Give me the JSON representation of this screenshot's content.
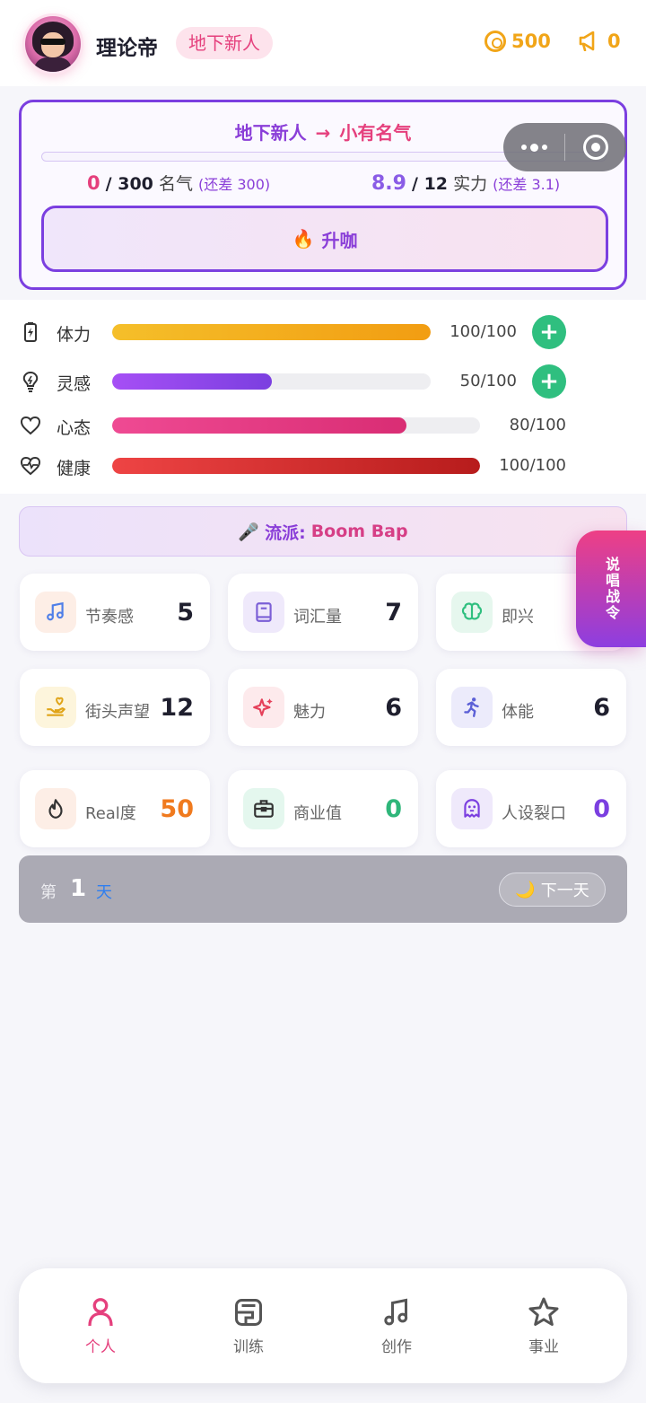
{
  "header": {
    "name": "理论帝",
    "rank_badge": "地下新人",
    "coins": "500",
    "fans": "0"
  },
  "promotion": {
    "from_rank": "地下新人",
    "arrow": "→",
    "to_rank": "小有名气",
    "progress_fraction": 0.0,
    "fame_current": "0",
    "fame_sep_total": "/ 300",
    "fame_label": "名气",
    "fame_gap": "(还差 300)",
    "power_current": "8.9",
    "power_sep_total": "/ 12",
    "power_label": "实力",
    "power_gap": "(还差 3.1)",
    "button_label": "升咖",
    "button_icon": "🔥"
  },
  "vitals": [
    {
      "label": "体力",
      "value_text": "100/100",
      "fraction": 1.0,
      "color_from": "#f5bf2a",
      "color_to": "#f29d12",
      "has_plus": true,
      "icon": "battery-icon"
    },
    {
      "label": "灵感",
      "value_text": "50/100",
      "fraction": 0.5,
      "color_from": "#a64ff5",
      "color_to": "#7b3fe0",
      "has_plus": true,
      "icon": "lightbulb-icon"
    },
    {
      "label": "心态",
      "value_text": "80/100",
      "fraction": 0.8,
      "color_from": "#ef4a93",
      "color_to": "#d92d74",
      "has_plus": false,
      "icon": "heart-icon"
    },
    {
      "label": "健康",
      "value_text": "100/100",
      "fraction": 1.0,
      "color_from": "#ee4444",
      "color_to": "#b71c1c",
      "has_plus": false,
      "icon": "heartbeat-icon"
    }
  ],
  "genre": {
    "icon": "🎤",
    "label": "流派:",
    "value": "Boom Bap"
  },
  "attributes": [
    {
      "label": "节奏感",
      "value": "5",
      "icon": "music-note-icon",
      "bg": "#fdeee6",
      "fg": "#4f7fe8",
      "value_color": "#1f1f2e"
    },
    {
      "label": "词汇量",
      "value": "7",
      "icon": "book-icon",
      "bg": "#efe9fb",
      "fg": "#7b5fd6",
      "value_color": "#1f1f2e"
    },
    {
      "label": "即兴",
      "value": "",
      "icon": "brain-icon",
      "bg": "#e6f7ee",
      "fg": "#2fbf7f",
      "value_color": "#1f1f2e"
    },
    {
      "label": "街头声望",
      "value": "12",
      "icon": "hand-icon",
      "bg": "#fdf5dc",
      "fg": "#e0a418",
      "value_color": "#1f1f2e"
    },
    {
      "label": "魅力",
      "value": "6",
      "icon": "sparkle-icon",
      "bg": "#fdeaec",
      "fg": "#e5405a",
      "value_color": "#1f1f2e"
    },
    {
      "label": "体能",
      "value": "6",
      "icon": "runner-icon",
      "bg": "#ecebfb",
      "fg": "#5b5fd6",
      "value_color": "#1f1f2e"
    },
    {
      "label": "Real度",
      "value": "50",
      "icon": "flame-icon",
      "bg": "#fdeee6",
      "fg": "#333333",
      "value_color": "#f07a1e"
    },
    {
      "label": "商业值",
      "value": "0",
      "icon": "briefcase-icon",
      "bg": "#e4f7ee",
      "fg": "#333333",
      "value_color": "#2fb67a"
    },
    {
      "label": "人设裂口",
      "value": "0",
      "icon": "ghost-icon",
      "bg": "#efe9fb",
      "fg": "#7b3fe0",
      "value_color": "#7b3fe0"
    }
  ],
  "side_tab": {
    "label": "说唱战令"
  },
  "day": {
    "prefix": "第",
    "number": "1",
    "unit": "天",
    "next_label": "下一天",
    "next_icon": "🌙"
  },
  "nav": [
    {
      "label": "个人",
      "icon": "person-icon",
      "active": true
    },
    {
      "label": "训练",
      "icon": "training-icon",
      "active": false
    },
    {
      "label": "创作",
      "icon": "music-note-icon",
      "active": false
    },
    {
      "label": "事业",
      "icon": "star-icon",
      "active": false
    }
  ],
  "colors": {
    "accent_pink": "#e5407d",
    "accent_purple": "#7b3fe0",
    "gold": "#f1a518",
    "green": "#2fbf7f"
  }
}
